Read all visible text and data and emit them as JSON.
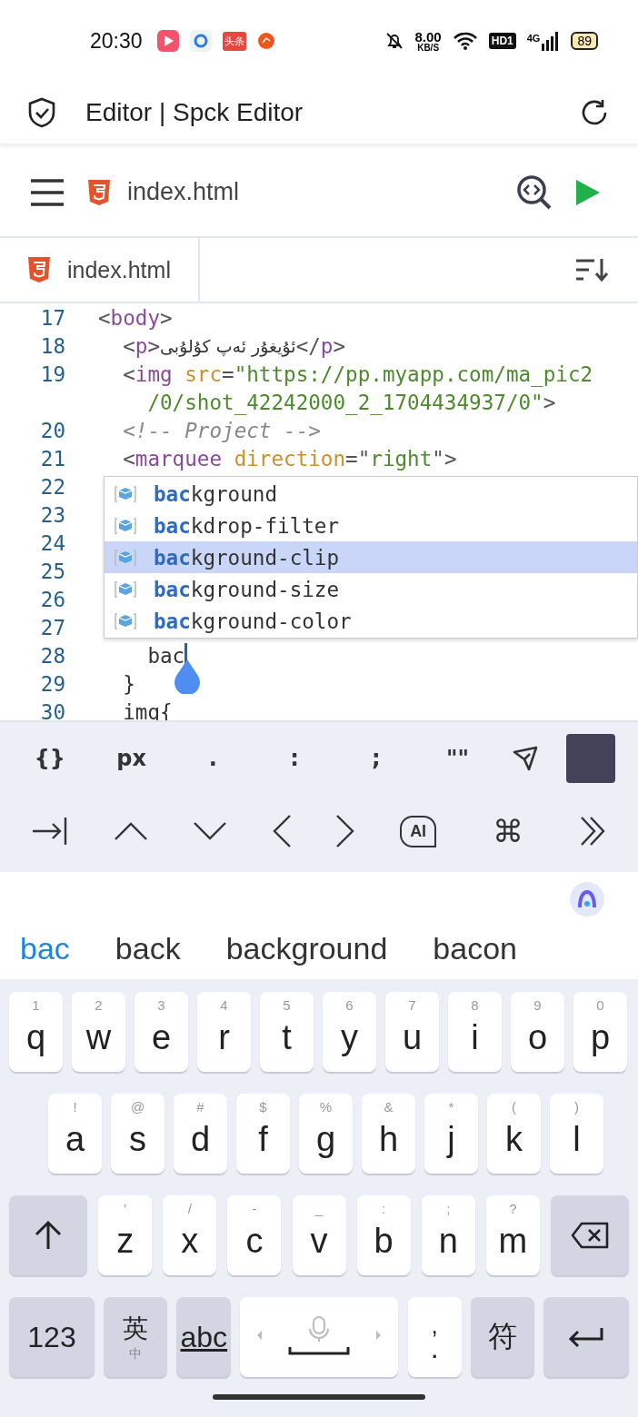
{
  "status_bar": {
    "time": "20:30",
    "notification_badge": "头条",
    "speed": "8.00",
    "speed_unit": "KB/S",
    "hd": "HD1",
    "network": "4G",
    "battery": "89"
  },
  "app_bar": {
    "title": "Editor | Spck Editor"
  },
  "toolbar": {
    "file": "index.html"
  },
  "tabs": [
    {
      "label": "index.html",
      "selected": true
    }
  ],
  "code": [
    {
      "number": "17",
      "tokens": [
        {
          "kind": "punct",
          "text": "<"
        },
        {
          "kind": "tag",
          "text": "body"
        },
        {
          "kind": "punct",
          "text": ">"
        }
      ]
    },
    {
      "number": "18",
      "tokens": [
        {
          "kind": "punct",
          "text": "  <"
        },
        {
          "kind": "tag",
          "text": "p"
        },
        {
          "kind": "punct",
          "text": ">"
        },
        {
          "kind": "rtl",
          "text": "ئۇيغۇر ئەپ كۇلۇبى"
        },
        {
          "kind": "punct",
          "text": "</"
        },
        {
          "kind": "tag",
          "text": "p"
        },
        {
          "kind": "punct",
          "text": ">"
        }
      ]
    },
    {
      "number": "19",
      "tokens": [
        {
          "kind": "punct",
          "text": "  <"
        },
        {
          "kind": "tag",
          "text": "img"
        },
        {
          "kind": "attr",
          "text": " src"
        },
        {
          "kind": "punct",
          "text": "="
        },
        {
          "kind": "string",
          "text": "\"https://pp.myapp.com/ma_pic2"
        }
      ]
    },
    {
      "tokens": [
        {
          "kind": "string",
          "text": "    /0/shot_42242000_2_1704434937/0\""
        },
        {
          "kind": "punct",
          "text": ">"
        }
      ]
    },
    {
      "number": "20",
      "tokens": [
        {
          "kind": "comment",
          "text": "  <!-- Project -->"
        }
      ]
    },
    {
      "number": "21",
      "tokens": [
        {
          "kind": "punct",
          "text": "  <"
        },
        {
          "kind": "tag",
          "text": "marquee"
        },
        {
          "kind": "attr",
          "text": " direction"
        },
        {
          "kind": "punct",
          "text": "=\""
        },
        {
          "kind": "string",
          "text": "right"
        },
        {
          "kind": "punct",
          "text": "\">"
        }
      ]
    },
    {
      "number": "22"
    },
    {
      "number": "23"
    },
    {
      "number": "24"
    },
    {
      "number": "25"
    },
    {
      "number": "26"
    },
    {
      "number": "27"
    },
    {
      "number": "28",
      "cursor": true,
      "tokens": [
        {
          "kind": "plain",
          "text": "    bac"
        }
      ]
    },
    {
      "number": "29",
      "tokens": [
        {
          "kind": "plain",
          "text": "  }"
        }
      ]
    },
    {
      "number": "30",
      "tokens": [
        {
          "kind": "plain",
          "text": "  img{"
        }
      ]
    }
  ],
  "autocomplete": [
    {
      "match": "bac",
      "rest": "kground",
      "selected": false
    },
    {
      "match": "bac",
      "rest": "kdrop-filter",
      "selected": false
    },
    {
      "match": "bac",
      "rest": "kground-clip",
      "selected": true
    },
    {
      "match": "bac",
      "rest": "kground-size",
      "selected": false
    },
    {
      "match": "bac",
      "rest": "kground-color",
      "selected": false
    }
  ],
  "accessory_row_1": [
    {
      "kind": "text",
      "label": "{}"
    },
    {
      "kind": "text",
      "label": "px"
    },
    {
      "kind": "text",
      "label": "."
    },
    {
      "kind": "text",
      "label": ":"
    },
    {
      "kind": "text",
      "label": ";"
    },
    {
      "kind": "text",
      "label": "\"\""
    },
    {
      "kind": "share"
    },
    {
      "kind": "swatch",
      "color": "#424259"
    }
  ],
  "accessory_row_2": [
    {
      "kind": "tab"
    },
    {
      "kind": "up"
    },
    {
      "kind": "down"
    },
    {
      "kind": "left"
    },
    {
      "kind": "right"
    },
    {
      "kind": "ai",
      "label": "AI"
    },
    {
      "kind": "text",
      "label": "⌘"
    },
    {
      "kind": "more"
    }
  ],
  "suggestions": [
    {
      "text": "bac",
      "selected": true
    },
    {
      "text": "back",
      "selected": false
    },
    {
      "text": "background",
      "selected": false
    },
    {
      "text": "bacon",
      "selected": false
    }
  ],
  "keyboard": [
    [
      {
        "kind": "letter",
        "label": "q",
        "hint": "1"
      },
      {
        "kind": "letter",
        "label": "w",
        "hint": "2"
      },
      {
        "kind": "letter",
        "label": "e",
        "hint": "3"
      },
      {
        "kind": "letter",
        "label": "r",
        "hint": "4"
      },
      {
        "kind": "letter",
        "label": "t",
        "hint": "5"
      },
      {
        "kind": "letter",
        "label": "y",
        "hint": "6"
      },
      {
        "kind": "letter",
        "label": "u",
        "hint": "7"
      },
      {
        "kind": "letter",
        "label": "i",
        "hint": "8"
      },
      {
        "kind": "letter",
        "label": "o",
        "hint": "9"
      },
      {
        "kind": "letter",
        "label": "p",
        "hint": "0"
      }
    ],
    [
      {
        "kind": "letter",
        "label": "a",
        "hint": "!"
      },
      {
        "kind": "letter",
        "label": "s",
        "hint": "@"
      },
      {
        "kind": "letter",
        "label": "d",
        "hint": "#"
      },
      {
        "kind": "letter",
        "label": "f",
        "hint": "$"
      },
      {
        "kind": "letter",
        "label": "g",
        "hint": "%"
      },
      {
        "kind": "letter",
        "label": "h",
        "hint": "&"
      },
      {
        "kind": "letter",
        "label": "j",
        "hint": "*"
      },
      {
        "kind": "letter",
        "label": "k",
        "hint": "("
      },
      {
        "kind": "letter",
        "label": "l",
        "hint": ")"
      }
    ],
    [
      {
        "kind": "shift"
      },
      {
        "kind": "letter",
        "label": "z",
        "hint": "'"
      },
      {
        "kind": "letter",
        "label": "x",
        "hint": "/"
      },
      {
        "kind": "letter",
        "label": "c",
        "hint": "-"
      },
      {
        "kind": "letter",
        "label": "v",
        "hint": "_"
      },
      {
        "kind": "letter",
        "label": "b",
        "hint": ":"
      },
      {
        "kind": "letter",
        "label": "n",
        "hint": ";"
      },
      {
        "kind": "letter",
        "label": "m",
        "hint": "?"
      },
      {
        "kind": "delete"
      }
    ],
    [
      {
        "kind": "mode",
        "label": "123"
      },
      {
        "kind": "lang",
        "label": "英",
        "hint": "中"
      },
      {
        "kind": "abc",
        "label": "abc"
      },
      {
        "kind": "space"
      },
      {
        "kind": "punct",
        "label": ".",
        "hint": ","
      },
      {
        "kind": "mode",
        "label": "符"
      },
      {
        "kind": "enter"
      }
    ]
  ]
}
